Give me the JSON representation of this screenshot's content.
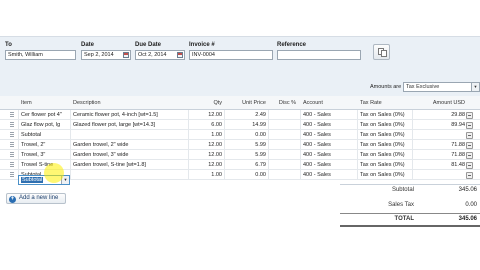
{
  "form": {
    "to_label": "To",
    "to_value": "Smith, William",
    "date_label": "Date",
    "date_value": "Sep 2, 2014",
    "due_label": "Due Date",
    "due_value": "Oct 2, 2014",
    "invoice_label": "Invoice #",
    "invoice_value": "INV-0004",
    "reference_label": "Reference",
    "reference_value": ""
  },
  "amounts": {
    "label": "Amounts are",
    "value": "Tax Exclusive"
  },
  "table": {
    "headers": {
      "item": "Item",
      "description": "Description",
      "qty": "Qty",
      "unit_price": "Unit Price",
      "disc": "Disc %",
      "account": "Account",
      "tax_rate": "Tax Rate",
      "amount": "Amount USD"
    },
    "rows": [
      {
        "item": "Cer flower pot 4\"",
        "description": "Ceramic flower pot, 4-inch [wt=1.5]",
        "qty": "12.00",
        "unit_price": "2.49",
        "disc": "",
        "account": "400 - Sales",
        "tax_rate": "Tax on Sales (0%)",
        "amount": "29.88"
      },
      {
        "item": "Glaz flow pot, lg",
        "description": "Glazed flower pot, large [wt=14.3]",
        "qty": "6.00",
        "unit_price": "14.99",
        "disc": "",
        "account": "400 - Sales",
        "tax_rate": "Tax on Sales (0%)",
        "amount": "89.94"
      },
      {
        "item": "Subtotal",
        "description": "",
        "qty": "1.00",
        "unit_price": "0.00",
        "disc": "",
        "account": "400 - Sales",
        "tax_rate": "Tax on Sales (0%)",
        "amount": ""
      },
      {
        "item": "Trowel, 2\"",
        "description": "Garden trowel, 2\" wide",
        "qty": "12.00",
        "unit_price": "5.99",
        "disc": "",
        "account": "400 - Sales",
        "tax_rate": "Tax on Sales (0%)",
        "amount": "71.88"
      },
      {
        "item": "Trowel, 3\"",
        "description": "Garden trowel, 3\" wide",
        "qty": "12.00",
        "unit_price": "5.99",
        "disc": "",
        "account": "400 - Sales",
        "tax_rate": "Tax on Sales (0%)",
        "amount": "71.88"
      },
      {
        "item": "Trowel S-tine",
        "description": "Garden trowel, S-tine [wt=1.8]",
        "qty": "12.00",
        "unit_price": "6.79",
        "disc": "",
        "account": "400 - Sales",
        "tax_rate": "Tax on Sales (0%)",
        "amount": "81.48"
      },
      {
        "item": "Subtotal",
        "description": "",
        "qty": "1.00",
        "unit_price": "0.00",
        "disc": "",
        "account": "400 - Sales",
        "tax_rate": "Tax on Sales (0%)",
        "amount": ""
      }
    ]
  },
  "add_line_label": "Add a new line",
  "totals": {
    "subtotal_label": "Subtotal",
    "subtotal_value": "345.06",
    "tax_label": "Sales Tax",
    "tax_value": "0.00",
    "total_label": "TOTAL",
    "total_value": "345.06"
  },
  "colors": {
    "accent": "#2a6db2",
    "panel": "#eaf0f6",
    "selection": "#2f6fb0"
  }
}
